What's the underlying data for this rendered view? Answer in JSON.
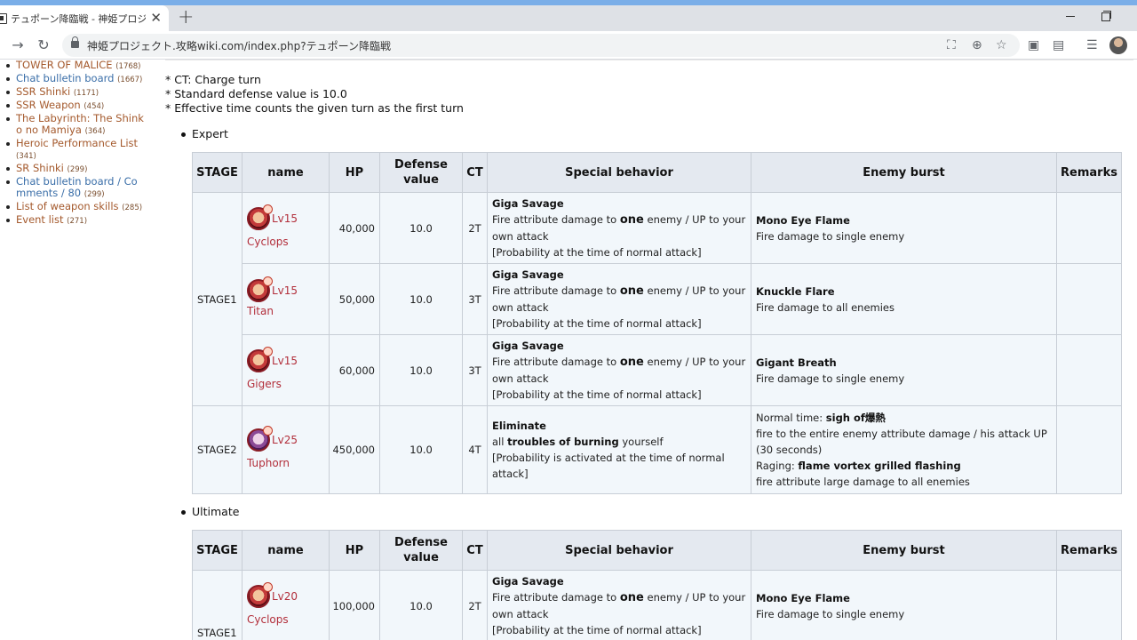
{
  "browser": {
    "tab_title": "テュポーン降臨戦 - 神姫プロジェクト攻略",
    "close_label": "✕",
    "new_tab_label": "+",
    "url": "神姫プロジェクト.攻略wiki.com/index.php?テュポーン降臨戦"
  },
  "sidebar": {
    "items": [
      {
        "label": "TOWER OF MALICE",
        "count": "(1768)"
      },
      {
        "label": "Chat bulletin board",
        "count": "(1667)"
      },
      {
        "label": "SSR Shinki",
        "count": "(1171)"
      },
      {
        "label": "SSR Weapon",
        "count": "(454)"
      },
      {
        "label": "The Labyrinth: The Shink o no Mamiya",
        "count": "(364)"
      },
      {
        "label": "Heroic Performance List",
        "count": "(341)"
      },
      {
        "label": "SR Shinki",
        "count": "(299)"
      },
      {
        "label": "Chat bulletin board / Co mments / 80",
        "count": "(299)"
      },
      {
        "label": "List of weapon skills",
        "count": "(285)"
      },
      {
        "label": "Event list",
        "count": "(271)"
      }
    ]
  },
  "notes": [
    "* CT: Charge turn",
    "* Standard defense value is 10.0",
    "* Effective time counts the given turn as the first turn"
  ],
  "headers": {
    "stage": "STAGE",
    "name": "name",
    "hp": "HP",
    "defense": "Defense value",
    "ct": "CT",
    "special": "Special behavior",
    "burst": "Enemy burst",
    "remarks": "Remarks"
  },
  "expert": {
    "title": "Expert",
    "stage1": "STAGE1",
    "stage2": "STAGE2",
    "rows": [
      {
        "lv": "Lv15",
        "name": "Cyclops",
        "hp": "40,000",
        "def": "10.0",
        "ct": "2T",
        "sp_title": "Giga Savage",
        "sp_pre": "Fire attribute damage to ",
        "sp_big": "one",
        "sp_post": " enemy / UP to your own attack",
        "sp_prob": "[Probability at the time of normal attack]",
        "burst_title": "Mono Eye Flame",
        "burst_desc": "Fire damage to single enemy"
      },
      {
        "lv": "Lv15 Titan",
        "name": "",
        "hp": "50,000",
        "def": "10.0",
        "ct": "3T",
        "sp_title": "Giga Savage",
        "sp_pre": "Fire attribute damage to ",
        "sp_big": "one",
        "sp_post": " enemy / UP to your own attack",
        "sp_prob": "[Probability at the time of normal attack]",
        "burst_title": "Knuckle Flare",
        "burst_desc": "Fire damage to all enemies"
      },
      {
        "lv": "Lv15",
        "name": "Gigers",
        "hp": "60,000",
        "def": "10.0",
        "ct": "3T",
        "sp_title": "Giga Savage",
        "sp_pre": "Fire attribute damage to ",
        "sp_big": "one",
        "sp_post": " enemy / UP to your own attack",
        "sp_prob": "[Probability at the time of normal attack]",
        "burst_title": "Gigant Breath",
        "burst_desc": "Fire damage to single enemy"
      }
    ],
    "stage2_row": {
      "lv": "Lv25",
      "name": "Tuphorn",
      "hp": "450,000",
      "def": "10.0",
      "ct": "4T",
      "sp_title": "Eliminate",
      "sp_all": "all ",
      "sp_bold": "troubles of burning",
      "sp_your": " yourself",
      "sp_prob": "[Probability is activated at the time of normal attack]",
      "normal_label": "Normal time: ",
      "normal_bold": "sigh of爆熱",
      "normal_desc": "fire to the entire enemy attribute damage / his attack UP (30 seconds)",
      "raging_label": "Raging: ",
      "raging_bold": "flame vortex grilled flashing",
      "raging_desc": "fire attribute large damage to all enemies"
    }
  },
  "ultimate": {
    "title": "Ultimate",
    "stage1": "STAGE1",
    "rows": [
      {
        "lv": "Lv20",
        "name": "Cyclops",
        "hp": "100,000",
        "def": "10.0",
        "ct": "2T",
        "sp_title": "Giga Savage",
        "sp_pre": "Fire attribute damage to ",
        "sp_big": "one",
        "sp_post": " enemy / UP to your own attack",
        "sp_prob": "[Probability at the time of normal attack]",
        "burst_title": "Mono Eye Flame",
        "burst_desc": "Fire damage to single enemy"
      }
    ]
  }
}
